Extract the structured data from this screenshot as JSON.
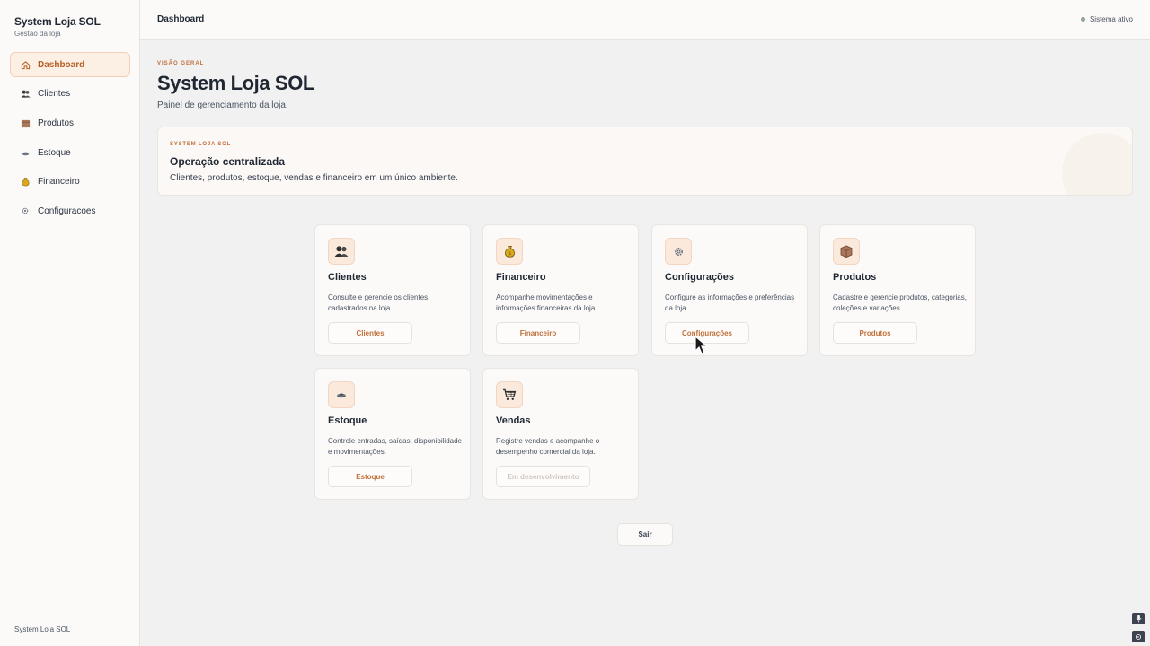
{
  "sidebar": {
    "brand_title": "System Loja SOL",
    "brand_subtitle": "Gestao da loja",
    "items": [
      {
        "label": "Dashboard",
        "icon": "home-icon",
        "active": true
      },
      {
        "label": "Clientes",
        "icon": "users-icon",
        "active": false
      },
      {
        "label": "Produtos",
        "icon": "box-icon",
        "active": false
      },
      {
        "label": "Estoque",
        "icon": "stock-icon",
        "active": false
      },
      {
        "label": "Financeiro",
        "icon": "money-bag-icon",
        "active": false
      },
      {
        "label": "Configuracoes",
        "icon": "gear-icon",
        "active": false
      }
    ],
    "footer": "System Loja SOL"
  },
  "topbar": {
    "title": "Dashboard",
    "status": "Sistema ativo"
  },
  "header": {
    "eyebrow": "VISÃO GERAL",
    "title": "System Loja SOL",
    "subtitle": "Painel de gerenciamento da loja."
  },
  "banner": {
    "eyebrow": "SYSTEM LOJA SOL",
    "title": "Operação centralizada",
    "text": "Clientes, produtos, estoque, vendas e financeiro em um único ambiente."
  },
  "cards": [
    {
      "title": "Clientes",
      "icon": "users-icon",
      "desc": "Consulte e gerencie os clientes cadastrados na loja.",
      "button": "Clientes",
      "disabled": false
    },
    {
      "title": "Financeiro",
      "icon": "money-bag-icon",
      "desc": "Acompanhe movimentações e informações financeiras da loja.",
      "button": "Financeiro",
      "disabled": false
    },
    {
      "title": "Configurações",
      "icon": "gear-icon",
      "desc": "Configure as informações e preferências da loja.",
      "button": "Configurações",
      "disabled": false
    },
    {
      "title": "Produtos",
      "icon": "box-icon",
      "desc": "Cadastre e gerencie produtos, categorias, coleções e variações.",
      "button": "Produtos",
      "disabled": false
    },
    {
      "title": "Estoque",
      "icon": "stock-icon",
      "desc": "Controle entradas, saídas, disponibilidade e movimentações.",
      "button": "Estoque",
      "disabled": false
    },
    {
      "title": "Vendas",
      "icon": "cart-icon",
      "desc": "Registre vendas e acompanhe o desempenho comercial da loja.",
      "button": "Em desenvolvimento",
      "disabled": true
    }
  ],
  "exit_button": "Sair",
  "colors": {
    "accent": "#c0703a",
    "active_bg": "#fcefe4",
    "status_dot": "#8fa49a"
  }
}
